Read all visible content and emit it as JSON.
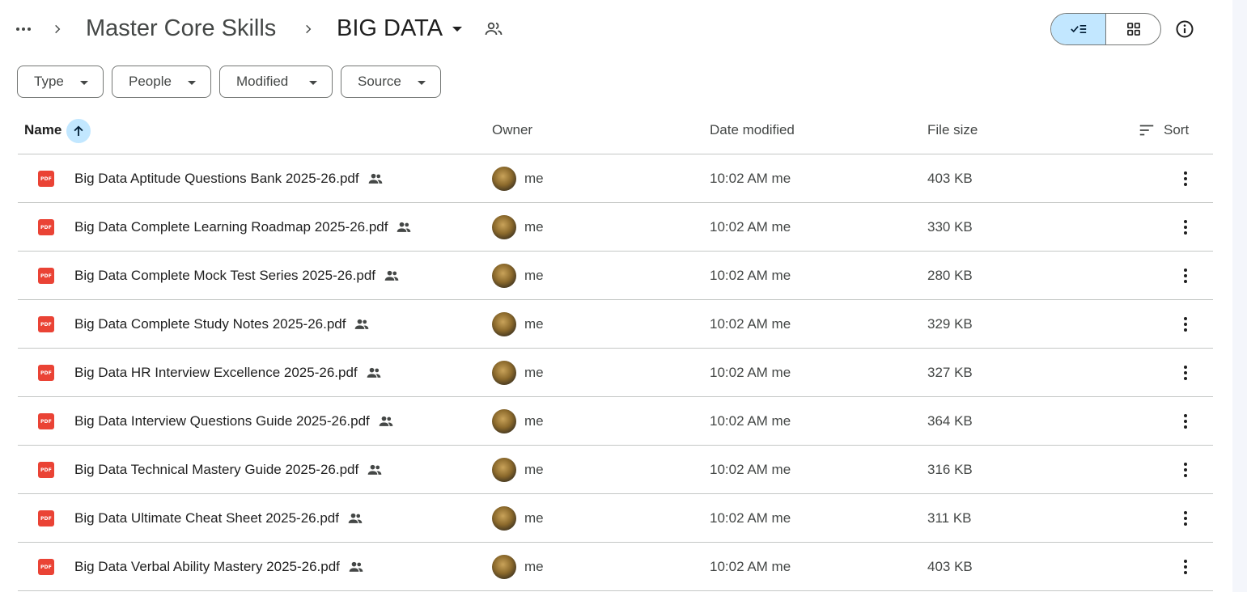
{
  "breadcrumb": {
    "parent": "Master Core Skills",
    "current": "BIG DATA"
  },
  "icons": {
    "more": "more-horiz-icon",
    "chevron": "chevron-right-icon",
    "shared_folder": "people-outline-icon",
    "list_view": "check-list-icon",
    "grid_view": "grid-view-icon",
    "info": "info-icon",
    "file": "pdf-icon",
    "shared": "people-icon",
    "sort": "sort-lines-icon",
    "row_more": "more-vert-icon"
  },
  "filters": [
    {
      "label": "Type"
    },
    {
      "label": "People"
    },
    {
      "label": "Modified"
    },
    {
      "label": "Source"
    }
  ],
  "columns": {
    "name": "Name",
    "owner": "Owner",
    "modified": "Date modified",
    "size": "File size",
    "sort": "Sort"
  },
  "file_badge": "PDF",
  "files": [
    {
      "name": "Big Data Aptitude Questions Bank 2025-26.pdf",
      "owner": "me",
      "modified": "10:02 AM me",
      "size": "403 KB"
    },
    {
      "name": "Big Data Complete Learning Roadmap 2025-26.pdf",
      "owner": "me",
      "modified": "10:02 AM me",
      "size": "330 KB"
    },
    {
      "name": "Big Data Complete Mock Test Series 2025-26.pdf",
      "owner": "me",
      "modified": "10:02 AM me",
      "size": "280 KB"
    },
    {
      "name": "Big Data Complete Study Notes 2025-26.pdf",
      "owner": "me",
      "modified": "10:02 AM me",
      "size": "329 KB"
    },
    {
      "name": "Big Data HR Interview Excellence 2025-26.pdf",
      "owner": "me",
      "modified": "10:02 AM me",
      "size": "327 KB"
    },
    {
      "name": "Big Data Interview Questions Guide 2025-26.pdf",
      "owner": "me",
      "modified": "10:02 AM me",
      "size": "364 KB"
    },
    {
      "name": "Big Data Technical Mastery Guide 2025-26.pdf",
      "owner": "me",
      "modified": "10:02 AM me",
      "size": "316 KB"
    },
    {
      "name": "Big Data Ultimate Cheat Sheet 2025-26.pdf",
      "owner": "me",
      "modified": "10:02 AM me",
      "size": "311 KB"
    },
    {
      "name": "Big Data Verbal Ability Mastery 2025-26.pdf",
      "owner": "me",
      "modified": "10:02 AM me",
      "size": "403 KB"
    }
  ],
  "colors": {
    "accent": "#c2e7ff",
    "pdf_red": "#ea4335",
    "divider": "#c4c7c5"
  }
}
